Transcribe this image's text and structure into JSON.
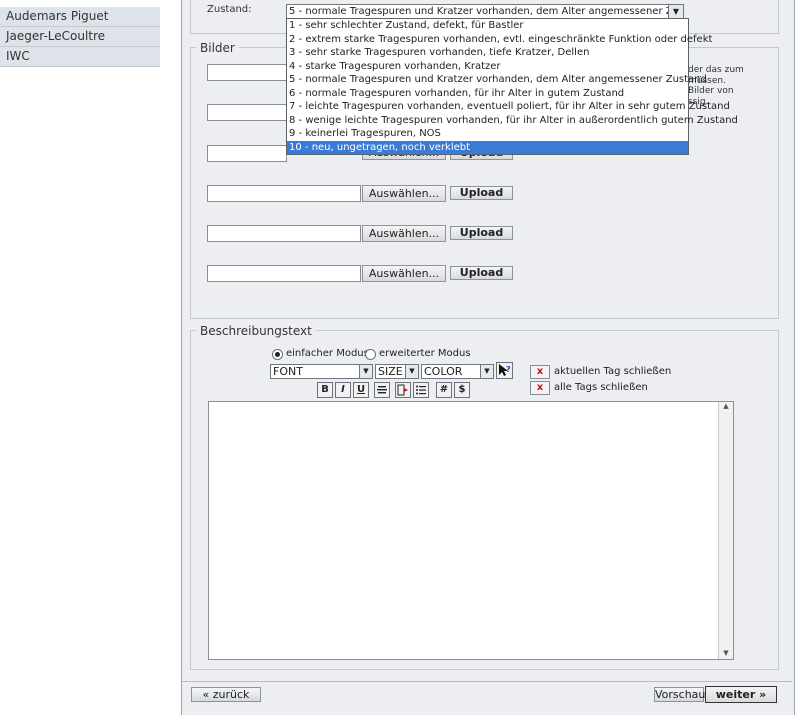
{
  "sidebar": {
    "items": [
      "Audemars Piguet",
      "Jaeger-LeCoultre",
      "IWC"
    ]
  },
  "zustand": {
    "label": "Zustand:",
    "selected": "5 - normale Tragespuren und Kratzer vorhanden, dem Alter angemessener Zustand",
    "options": [
      "1 - sehr schlechter Zustand, defekt, für Bastler",
      "2 - extrem starke Tragespuren vorhanden, evtl. eingeschränkte Funktion oder defekt",
      "3 - sehr starke Tragespuren vorhanden, tiefe Kratzer, Dellen",
      "4 - starke Tragespuren vorhanden, Kratzer",
      "5 - normale Tragespuren und Kratzer vorhanden, dem Alter angemessener Zustand",
      "6 - normale Tragespuren vorhanden, für ihr Alter in gutem Zustand",
      "7 - leichte Tragespuren vorhanden, eventuell poliert, für ihr Alter in sehr gutem Zustand",
      "8 - wenige leichte Tragespuren vorhanden, für ihr Alter in außerordentlich gutem Zustand",
      "9 - keinerlei Tragespuren, NOS",
      "10 - neu, ungetragen, noch verklebt"
    ],
    "highlighted_index": 9
  },
  "bilder": {
    "legend": "Bilder",
    "choose_label": "Auswählen...",
    "upload_label": "Upload",
    "partial_upload_label": "Upload",
    "partial_choose_label": "Auswählen...",
    "hint_lines": [
      "der das zum",
      "müssen.",
      "Bilder von",
      "ssig."
    ]
  },
  "beschreibung": {
    "legend": "Beschreibungstext",
    "mode_simple": "einfacher Modus",
    "mode_advanced": "erweiterter Modus",
    "font_select": "FONT",
    "size_select": "SIZE",
    "color_select": "COLOR",
    "close_current_tag": "aktuellen Tag schließen",
    "close_all_tags": "alle Tags schließen",
    "x_label": "x",
    "toolbar": {
      "bold": "B",
      "italic": "I",
      "underline": "U",
      "hash": "#",
      "dollar": "$"
    }
  },
  "footer": {
    "back": "« zurück",
    "preview": "Vorschau",
    "next": "weiter »"
  }
}
